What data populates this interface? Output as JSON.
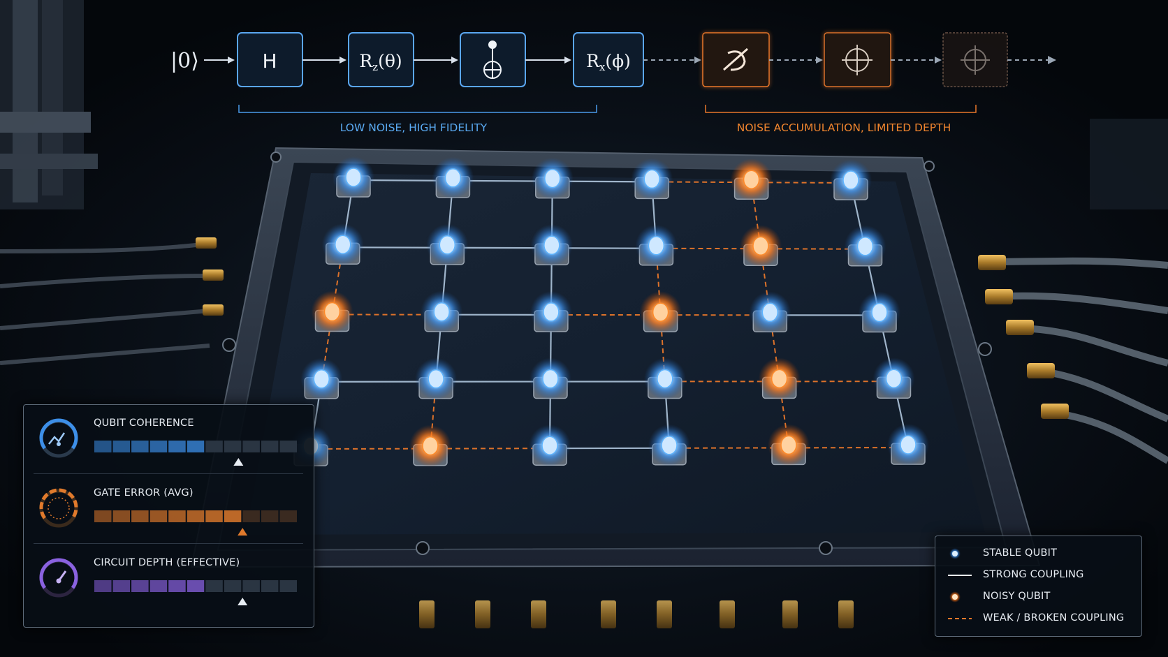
{
  "circuit": {
    "input_state": "|0⟩",
    "gates": [
      {
        "label": "H",
        "kind": "clean"
      },
      {
        "label": "R",
        "sub": "z",
        "arg": "(θ)",
        "kind": "clean"
      },
      {
        "label": "",
        "symbol": "cnot",
        "kind": "clean"
      },
      {
        "label": "R",
        "sub": "x",
        "arg": "(ϕ)",
        "kind": "clean"
      },
      {
        "label": "",
        "symbol": "noisy-measure",
        "kind": "noisy"
      },
      {
        "label": "",
        "symbol": "crosshair",
        "kind": "noisy"
      },
      {
        "label": "",
        "symbol": "crosshair",
        "kind": "degraded"
      }
    ],
    "region_low_noise": "LOW NOISE, HIGH FIDELITY",
    "region_noisy": "NOISE ACCUMULATION, LIMITED DEPTH"
  },
  "chip": {
    "rows": [
      [
        "stable",
        "stable",
        "stable",
        "stable",
        "noisy",
        "stable"
      ],
      [
        "stable",
        "stable",
        "stable",
        "stable",
        "noisy",
        "stable"
      ],
      [
        "noisy",
        "stable",
        "stable",
        "noisy",
        "stable",
        "stable"
      ],
      [
        "stable",
        "stable",
        "stable",
        "stable",
        "noisy",
        "stable"
      ],
      [
        "stable",
        "noisy",
        "stable",
        "stable",
        "noisy",
        "stable"
      ]
    ]
  },
  "metrics": [
    {
      "label": "QUBIT COHERENCE",
      "icon": "coherence-gauge-icon",
      "fill": 0.57,
      "marker": 0.71,
      "color": "#3d8fe8",
      "dim": "#2a3542"
    },
    {
      "label": "GATE ERROR (AVG)",
      "icon": "error-gauge-icon",
      "fill": 0.73,
      "marker": 0.73,
      "color": "#e07a2c",
      "dim": "#3a2a20"
    },
    {
      "label": "CIRCUIT DEPTH (EFFECTIVE)",
      "icon": "depth-gauge-icon",
      "fill": 0.55,
      "marker": 0.73,
      "color": "#8a62e0",
      "dim": "#2a3542"
    }
  ],
  "legend": [
    {
      "label": "STABLE QUBIT",
      "symbol": "stable-qubit-icon"
    },
    {
      "label": "STRONG COUPLING",
      "symbol": "strong-coupling-line"
    },
    {
      "label": "NOISY QUBIT",
      "symbol": "noisy-qubit-icon"
    },
    {
      "label": "WEAK / BROKEN COUPLING",
      "symbol": "weak-coupling-line"
    }
  ],
  "colors": {
    "stable": "#5eb4ff",
    "noisy": "#ff8a2a",
    "accent_blue": "#4a9bea",
    "accent_orange": "#e8772a"
  }
}
